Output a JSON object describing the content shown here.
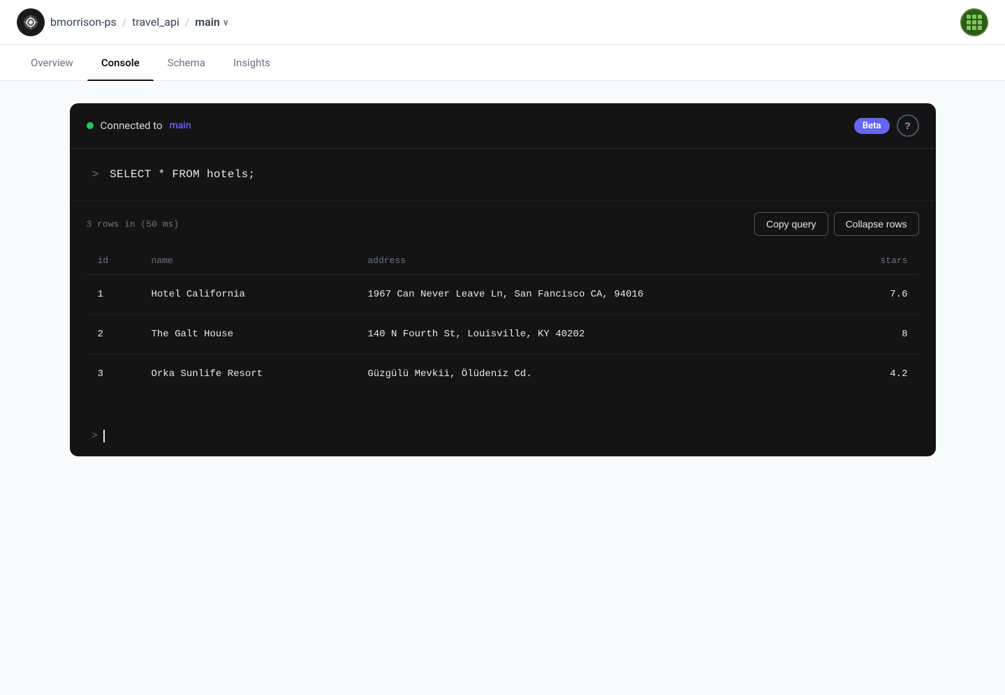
{
  "header": {
    "org": "bmorrison-ps",
    "project": "travel_api",
    "branch": "main",
    "avatar_alt": "User avatar"
  },
  "tabs": [
    {
      "id": "overview",
      "label": "Overview",
      "active": false
    },
    {
      "id": "console",
      "label": "Console",
      "active": true
    },
    {
      "id": "schema",
      "label": "Schema",
      "active": false
    },
    {
      "id": "insights",
      "label": "Insights",
      "active": false
    }
  ],
  "console": {
    "status": {
      "connected_label": "Connected to",
      "branch_link": "main",
      "beta_label": "Beta",
      "help_label": "?"
    },
    "query": {
      "prompt": ">",
      "text": "SELECT * FROM hotels;"
    },
    "results": {
      "info": "3 rows in (50 ms)",
      "copy_btn": "Copy query",
      "collapse_btn": "Collapse rows",
      "columns": [
        "id",
        "name",
        "address",
        "stars"
      ],
      "rows": [
        {
          "id": "1",
          "name": "Hotel California",
          "address": "1967 Can Never Leave Ln, San Fancisco CA, 94016",
          "stars": "7.6"
        },
        {
          "id": "2",
          "name": "The Galt House",
          "address": "140 N Fourth St, Louisville, KY 40202",
          "stars": "8"
        },
        {
          "id": "3",
          "name": "Orka Sunlife Resort",
          "address": "Güzgülü Mevkii, Ölüdeniz Cd.",
          "stars": "4.2"
        }
      ]
    },
    "cursor_prompt": ">"
  }
}
